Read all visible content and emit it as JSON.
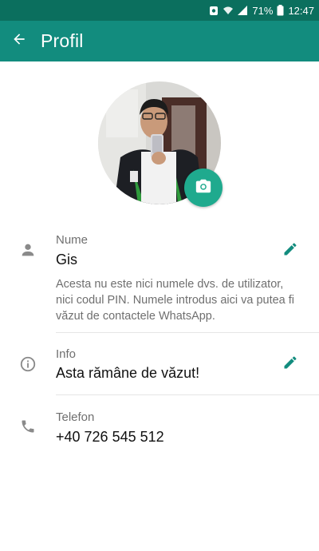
{
  "status_bar": {
    "battery_percent": "71%",
    "time": "12:47"
  },
  "app_bar": {
    "title": "Profil"
  },
  "profile": {
    "name_label": "Nume",
    "name_value": "Gis",
    "name_hint": "Acesta nu este nici numele dvs. de utilizator, nici codul PIN. Numele introdus aici va putea fi văzut de contactele WhatsApp.",
    "info_label": "Info",
    "info_value": "Asta rămâne de văzut!",
    "phone_label": "Telefon",
    "phone_value": "+40 726 545 512"
  },
  "colors": {
    "status_bar": "#0b6f5e",
    "app_bar": "#128c7e",
    "accent": "#1faa8e",
    "icon_gray": "#8a8a8a"
  },
  "icons": [
    "back-arrow-icon",
    "camera-icon",
    "person-icon",
    "pencil-icon",
    "info-icon",
    "phone-icon"
  ]
}
